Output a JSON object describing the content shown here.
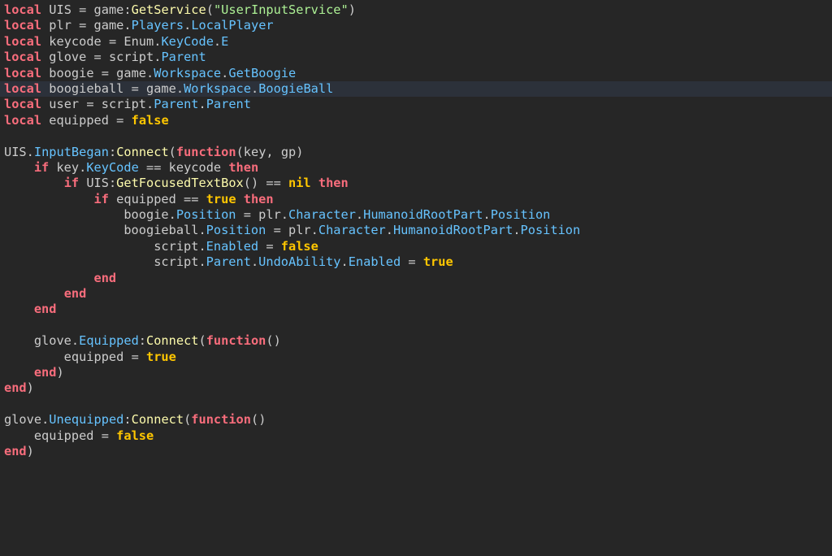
{
  "editor": {
    "current_line_index": 5,
    "colors": {
      "background": "#262626",
      "current_line": "#2c313a",
      "keyword": "#f86d7c",
      "text": "#cccccc",
      "property": "#66c3ff",
      "method": "#fdfbac",
      "string": "#adf195",
      "boolean": "#ffc600"
    },
    "lines": [
      [
        [
          "kw",
          "local"
        ],
        [
          "ident",
          " UIS "
        ],
        [
          "op",
          "="
        ],
        [
          "ident",
          " game"
        ],
        [
          "op",
          ":"
        ],
        [
          "method",
          "GetService"
        ],
        [
          "punct",
          "("
        ],
        [
          "str",
          "\"UserInputService\""
        ],
        [
          "punct",
          ")"
        ]
      ],
      [
        [
          "kw",
          "local"
        ],
        [
          "ident",
          " plr "
        ],
        [
          "op",
          "="
        ],
        [
          "ident",
          " game"
        ],
        [
          "op",
          "."
        ],
        [
          "prop",
          "Players"
        ],
        [
          "op",
          "."
        ],
        [
          "prop",
          "LocalPlayer"
        ]
      ],
      [
        [
          "kw",
          "local"
        ],
        [
          "ident",
          " keycode "
        ],
        [
          "op",
          "="
        ],
        [
          "ident",
          " Enum"
        ],
        [
          "op",
          "."
        ],
        [
          "prop",
          "KeyCode"
        ],
        [
          "op",
          "."
        ],
        [
          "prop",
          "E"
        ]
      ],
      [
        [
          "kw",
          "local"
        ],
        [
          "ident",
          " glove "
        ],
        [
          "op",
          "="
        ],
        [
          "ident",
          " script"
        ],
        [
          "op",
          "."
        ],
        [
          "prop",
          "Parent"
        ]
      ],
      [
        [
          "kw",
          "local"
        ],
        [
          "ident",
          " boogie "
        ],
        [
          "op",
          "="
        ],
        [
          "ident",
          " game"
        ],
        [
          "op",
          "."
        ],
        [
          "prop",
          "Workspace"
        ],
        [
          "op",
          "."
        ],
        [
          "prop",
          "GetBoogie"
        ]
      ],
      [
        [
          "kw",
          "local"
        ],
        [
          "ident",
          " boogieball "
        ],
        [
          "op",
          "="
        ],
        [
          "ident",
          " game"
        ],
        [
          "op",
          "."
        ],
        [
          "prop",
          "Workspace"
        ],
        [
          "op",
          "."
        ],
        [
          "prop",
          "BoogieBall"
        ]
      ],
      [
        [
          "kw",
          "local"
        ],
        [
          "ident",
          " user "
        ],
        [
          "op",
          "="
        ],
        [
          "ident",
          " script"
        ],
        [
          "op",
          "."
        ],
        [
          "prop",
          "Parent"
        ],
        [
          "op",
          "."
        ],
        [
          "prop",
          "Parent"
        ]
      ],
      [
        [
          "kw",
          "local"
        ],
        [
          "ident",
          " equipped "
        ],
        [
          "op",
          "="
        ],
        [
          "ident",
          " "
        ],
        [
          "bool",
          "false"
        ]
      ],
      [],
      [
        [
          "ident",
          "UIS"
        ],
        [
          "op",
          "."
        ],
        [
          "prop",
          "InputBegan"
        ],
        [
          "op",
          ":"
        ],
        [
          "method",
          "Connect"
        ],
        [
          "punct",
          "("
        ],
        [
          "kw",
          "function"
        ],
        [
          "punct",
          "("
        ],
        [
          "ident",
          "key, gp"
        ],
        [
          "punct",
          ")"
        ]
      ],
      [
        [
          "ident",
          "    "
        ],
        [
          "kw",
          "if"
        ],
        [
          "ident",
          " key"
        ],
        [
          "op",
          "."
        ],
        [
          "prop",
          "KeyCode"
        ],
        [
          "ident",
          " "
        ],
        [
          "op",
          "=="
        ],
        [
          "ident",
          " keycode "
        ],
        [
          "kw",
          "then"
        ]
      ],
      [
        [
          "ident",
          "        "
        ],
        [
          "kw",
          "if"
        ],
        [
          "ident",
          " UIS"
        ],
        [
          "op",
          ":"
        ],
        [
          "method",
          "GetFocusedTextBox"
        ],
        [
          "punct",
          "()"
        ],
        [
          "ident",
          " "
        ],
        [
          "op",
          "=="
        ],
        [
          "ident",
          " "
        ],
        [
          "bool",
          "nil"
        ],
        [
          "ident",
          " "
        ],
        [
          "kw",
          "then"
        ]
      ],
      [
        [
          "ident",
          "            "
        ],
        [
          "kw",
          "if"
        ],
        [
          "ident",
          " equipped "
        ],
        [
          "op",
          "=="
        ],
        [
          "ident",
          " "
        ],
        [
          "bool",
          "true"
        ],
        [
          "ident",
          " "
        ],
        [
          "kw",
          "then"
        ]
      ],
      [
        [
          "ident",
          "                boogie"
        ],
        [
          "op",
          "."
        ],
        [
          "prop",
          "Position"
        ],
        [
          "ident",
          " "
        ],
        [
          "op",
          "="
        ],
        [
          "ident",
          " plr"
        ],
        [
          "op",
          "."
        ],
        [
          "prop",
          "Character"
        ],
        [
          "op",
          "."
        ],
        [
          "prop",
          "HumanoidRootPart"
        ],
        [
          "op",
          "."
        ],
        [
          "prop",
          "Position"
        ]
      ],
      [
        [
          "ident",
          "                boogieball"
        ],
        [
          "op",
          "."
        ],
        [
          "prop",
          "Position"
        ],
        [
          "ident",
          " "
        ],
        [
          "op",
          "="
        ],
        [
          "ident",
          " plr"
        ],
        [
          "op",
          "."
        ],
        [
          "prop",
          "Character"
        ],
        [
          "op",
          "."
        ],
        [
          "prop",
          "HumanoidRootPart"
        ],
        [
          "op",
          "."
        ],
        [
          "prop",
          "Position"
        ]
      ],
      [
        [
          "ident",
          "                    script"
        ],
        [
          "op",
          "."
        ],
        [
          "prop",
          "Enabled"
        ],
        [
          "ident",
          " "
        ],
        [
          "op",
          "="
        ],
        [
          "ident",
          " "
        ],
        [
          "bool",
          "false"
        ]
      ],
      [
        [
          "ident",
          "                    script"
        ],
        [
          "op",
          "."
        ],
        [
          "prop",
          "Parent"
        ],
        [
          "op",
          "."
        ],
        [
          "prop",
          "UndoAbility"
        ],
        [
          "op",
          "."
        ],
        [
          "prop",
          "Enabled"
        ],
        [
          "ident",
          " "
        ],
        [
          "op",
          "="
        ],
        [
          "ident",
          " "
        ],
        [
          "bool",
          "true"
        ]
      ],
      [
        [
          "ident",
          "            "
        ],
        [
          "kw",
          "end"
        ]
      ],
      [
        [
          "ident",
          "        "
        ],
        [
          "kw",
          "end"
        ]
      ],
      [
        [
          "ident",
          "    "
        ],
        [
          "kw",
          "end"
        ]
      ],
      [],
      [
        [
          "ident",
          "    glove"
        ],
        [
          "op",
          "."
        ],
        [
          "prop",
          "Equipped"
        ],
        [
          "op",
          ":"
        ],
        [
          "method",
          "Connect"
        ],
        [
          "punct",
          "("
        ],
        [
          "kw",
          "function"
        ],
        [
          "punct",
          "()"
        ]
      ],
      [
        [
          "ident",
          "        equipped "
        ],
        [
          "op",
          "="
        ],
        [
          "ident",
          " "
        ],
        [
          "bool",
          "true"
        ]
      ],
      [
        [
          "ident",
          "    "
        ],
        [
          "kw",
          "end"
        ],
        [
          "punct",
          ")"
        ]
      ],
      [
        [
          "kw",
          "end"
        ],
        [
          "punct",
          ")"
        ]
      ],
      [],
      [
        [
          "ident",
          "glove"
        ],
        [
          "op",
          "."
        ],
        [
          "prop",
          "Unequipped"
        ],
        [
          "op",
          ":"
        ],
        [
          "method",
          "Connect"
        ],
        [
          "punct",
          "("
        ],
        [
          "kw",
          "function"
        ],
        [
          "punct",
          "()"
        ]
      ],
      [
        [
          "ident",
          "    equipped "
        ],
        [
          "op",
          "="
        ],
        [
          "ident",
          " "
        ],
        [
          "bool",
          "false"
        ]
      ],
      [
        [
          "kw",
          "end"
        ],
        [
          "punct",
          ")"
        ]
      ]
    ]
  }
}
